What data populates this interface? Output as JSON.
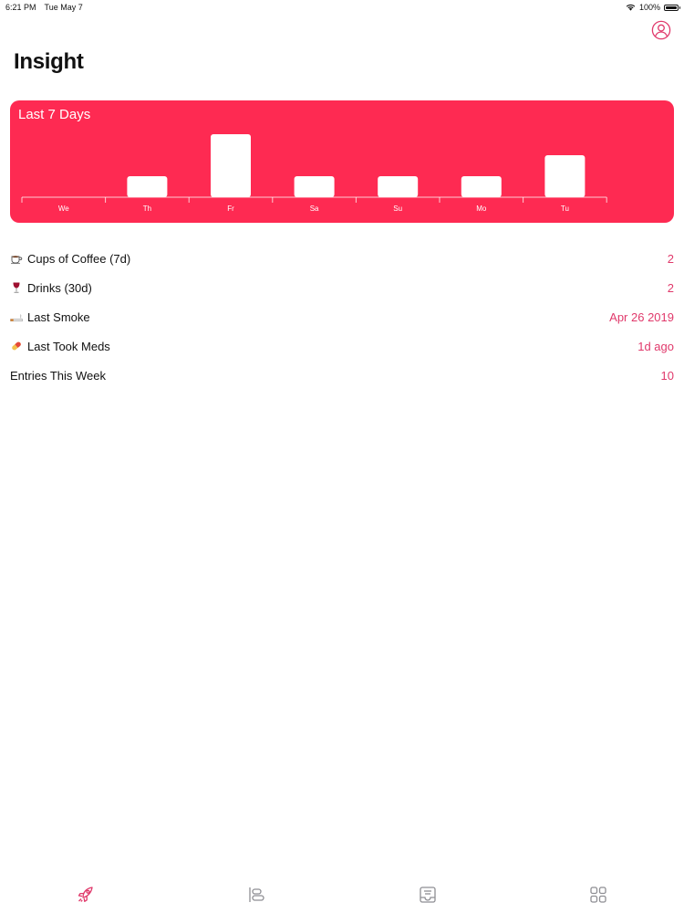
{
  "status_bar": {
    "time": "6:21 PM",
    "date": "Tue May 7",
    "battery": "100%",
    "battery_level": 1.0
  },
  "header": {
    "title": "Insight",
    "profile_icon": "person-circle-icon"
  },
  "colors": {
    "accent": "#e0396b",
    "chart_background": "#fe2a52",
    "bar": "#ffffff",
    "tab_inactive": "#8e8e93"
  },
  "chart_data": {
    "type": "bar",
    "title": "Last 7 Days",
    "categories": [
      "We",
      "Th",
      "Fr",
      "Sa",
      "Su",
      "Mo",
      "Tu"
    ],
    "values": [
      0,
      1,
      3,
      1,
      1,
      1,
      2
    ],
    "ylim": [
      0,
      3
    ],
    "grid": false,
    "legend": "none"
  },
  "stats": [
    {
      "icon": "coffee-icon",
      "label": "Cups of Coffee (7d)",
      "value": "2"
    },
    {
      "icon": "wine-glass-icon",
      "label": "Drinks (30d)",
      "value": "2"
    },
    {
      "icon": "cigarette-icon",
      "label": "Last Smoke",
      "value": "Apr 26 2019"
    },
    {
      "icon": "pill-icon",
      "label": "Last Took Meds",
      "value": "1d ago"
    },
    {
      "icon": "",
      "label": "Entries This Week",
      "value": "10"
    }
  ],
  "tab_bar": [
    {
      "icon": "rocket-icon",
      "active": true
    },
    {
      "icon": "timeline-icon",
      "active": false
    },
    {
      "icon": "tray-list-icon",
      "active": false
    },
    {
      "icon": "grid-icon",
      "active": false
    }
  ]
}
